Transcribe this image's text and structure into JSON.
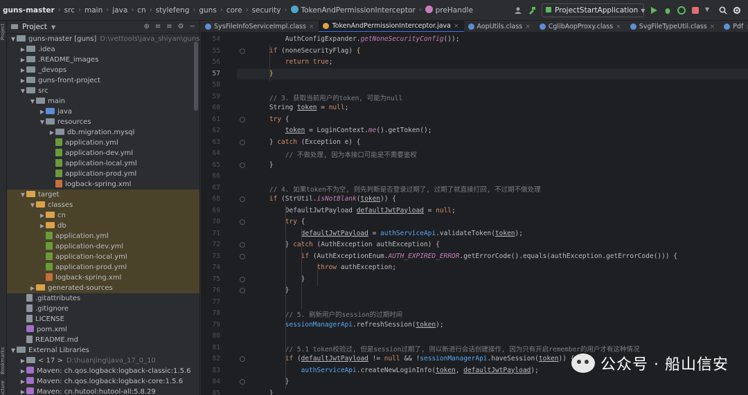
{
  "breadcrumbs": [
    "guns-master",
    "src",
    "main",
    "java",
    "cn",
    "stylefeng",
    "guns",
    "core",
    "security",
    "TokenAndPermissionInterceptor",
    "preHandle"
  ],
  "run_config": "ProjectStartApplication",
  "tool_strip": {
    "project": "Project",
    "bookmarks": "Bookmarks",
    "structure": "Structure"
  },
  "project_panel": {
    "title": "Project"
  },
  "tree": [
    {
      "label": "guns-master [guns]",
      "note": "D:\\vettools\\java_shiyan\\guns-maste",
      "depth": 0,
      "arrow": "v",
      "icon": "folder"
    },
    {
      "label": ".idea",
      "depth": 1,
      "arrow": ">",
      "icon": "folder"
    },
    {
      "label": ".README_images",
      "depth": 1,
      "arrow": ">",
      "icon": "folder"
    },
    {
      "label": "_devops",
      "depth": 1,
      "arrow": ">",
      "icon": "folder"
    },
    {
      "label": "guns-front-project",
      "depth": 1,
      "arrow": ">",
      "icon": "folder"
    },
    {
      "label": "src",
      "depth": 1,
      "arrow": "v",
      "icon": "folder"
    },
    {
      "label": "main",
      "depth": 2,
      "arrow": "v",
      "icon": "folder"
    },
    {
      "label": "java",
      "depth": 3,
      "arrow": ">",
      "icon": "folder-blue"
    },
    {
      "label": "resources",
      "depth": 3,
      "arrow": "v",
      "icon": "folder"
    },
    {
      "label": "db.migration.mysql",
      "depth": 4,
      "arrow": ">",
      "icon": "folder"
    },
    {
      "label": "application.yml",
      "depth": 4,
      "arrow": "",
      "icon": "yml"
    },
    {
      "label": "application-dev.yml",
      "depth": 4,
      "arrow": "",
      "icon": "yml"
    },
    {
      "label": "application-local.yml",
      "depth": 4,
      "arrow": "",
      "icon": "yml"
    },
    {
      "label": "application-prod.yml",
      "depth": 4,
      "arrow": "",
      "icon": "yml"
    },
    {
      "label": "logback-spring.xml",
      "depth": 4,
      "arrow": "",
      "icon": "xml"
    },
    {
      "label": "target",
      "depth": 1,
      "arrow": "v",
      "icon": "folder-orange",
      "hl": true
    },
    {
      "label": "classes",
      "depth": 2,
      "arrow": "v",
      "icon": "folder-orange",
      "hl": true
    },
    {
      "label": "cn",
      "depth": 3,
      "arrow": ">",
      "icon": "folder-orange",
      "hl": true
    },
    {
      "label": "db",
      "depth": 3,
      "arrow": ">",
      "icon": "folder-orange",
      "hl": true
    },
    {
      "label": "application.yml",
      "depth": 3,
      "arrow": "",
      "icon": "yml",
      "hl": true
    },
    {
      "label": "application-dev.yml",
      "depth": 3,
      "arrow": "",
      "icon": "yml",
      "hl": true
    },
    {
      "label": "application-local.yml",
      "depth": 3,
      "arrow": "",
      "icon": "yml",
      "hl": true
    },
    {
      "label": "application-prod.yml",
      "depth": 3,
      "arrow": "",
      "icon": "yml",
      "hl": true
    },
    {
      "label": "logback-spring.xml",
      "depth": 3,
      "arrow": "",
      "icon": "xml",
      "hl": true
    },
    {
      "label": "generated-sources",
      "depth": 2,
      "arrow": ">",
      "icon": "folder-orange",
      "hl": true
    },
    {
      "label": ".gitattributes",
      "depth": 1,
      "arrow": "",
      "icon": "txt"
    },
    {
      "label": ".gitignore",
      "depth": 1,
      "arrow": "",
      "icon": "txt"
    },
    {
      "label": "LICENSE",
      "depth": 1,
      "arrow": "",
      "icon": "txt"
    },
    {
      "label": "pom.xml",
      "depth": 1,
      "arrow": "",
      "icon": "mvn"
    },
    {
      "label": "README.md",
      "depth": 1,
      "arrow": "",
      "icon": "txt"
    },
    {
      "label": "External Libraries",
      "depth": 0,
      "arrow": "v",
      "icon": "folder"
    },
    {
      "label": "< 17 >",
      "note": "D:\\huanjing\\java_17_0_10",
      "depth": 1,
      "arrow": ">",
      "icon": "folder"
    },
    {
      "label": "Maven: ch.qos.logback:logback-classic:1.5.6",
      "depth": 1,
      "arrow": ">",
      "icon": "mvn"
    },
    {
      "label": "Maven: ch.qos.logback:logback-core:1.5.6",
      "depth": 1,
      "arrow": ">",
      "icon": "mvn"
    },
    {
      "label": "Maven: cn.hutool:hutool-all:5.8.29",
      "depth": 1,
      "arrow": ">",
      "icon": "mvn"
    }
  ],
  "tabs": [
    {
      "label": "SysFileInfoServiceImpl.class",
      "color": "#5d8ed6",
      "active": false
    },
    {
      "label": "TokenAndPermissionInterceptor.java",
      "color": "#d9a34b",
      "active": true
    },
    {
      "label": "AopUtils.class",
      "color": "#5d8ed6",
      "active": false
    },
    {
      "label": "CglibAopProxy.class",
      "color": "#5d8ed6",
      "active": false
    },
    {
      "label": "SvgFileTypeUtil.class",
      "color": "#5d8ed6",
      "active": false
    },
    {
      "label": "Pdf",
      "color": "#5d8ed6",
      "active": false
    }
  ],
  "current_line": "57",
  "code_lines": [
    {
      "n": "54",
      "html": "        AuthConfigExpander.<span class=\"s\">getNoneSecurityConfig</span>());"
    },
    {
      "n": "55",
      "html": "    <span class=\"k\">if</span> (noneSecurityFlag) <span class=\"b\">{</span>"
    },
    {
      "n": "56",
      "html": "        <span class=\"k\">return true</span>;"
    },
    {
      "n": "57",
      "html": "    <span class=\"b\">}</span>"
    },
    {
      "n": "58",
      "html": ""
    },
    {
      "n": "59",
      "html": "    <span class=\"c\">// 3. 获取当前用户的token, 可能为null</span>"
    },
    {
      "n": "60",
      "html": "    String <span class=\"u\">token</span> = <span class=\"k\">null</span>;"
    },
    {
      "n": "61",
      "html": "    <span class=\"k\">try</span> {"
    },
    {
      "n": "62",
      "html": "        <span class=\"u\">token</span> = LoginContext.<span class=\"s\">me</span>().getToken();"
    },
    {
      "n": "63",
      "html": "    } <span class=\"k\">catch</span> (Exception e) {"
    },
    {
      "n": "64",
      "html": "        <span class=\"c\">// 不做处理, 因为本接口可能是不需要鉴权</span>"
    },
    {
      "n": "65",
      "html": "    }"
    },
    {
      "n": "66",
      "html": ""
    },
    {
      "n": "67",
      "html": "    <span class=\"c\">// 4. 如果token不为空, 则先判断是否登录过期了, 过期了就直接打回, 不过期不做处理</span>"
    },
    {
      "n": "68",
      "html": "    <span class=\"k\">if</span> (StrUtil.<span class=\"s\">isNotBlank</span>(<span class=\"u\">token</span>)) {"
    },
    {
      "n": "69",
      "html": "        DefaultJwtPayload <span class=\"u\">defaultJwtPayload</span> = <span class=\"k\">null</span>;"
    },
    {
      "n": "70",
      "html": "        <span class=\"k\">try</span> {"
    },
    {
      "n": "71",
      "html": "            <span class=\"u\">defaultJwtPayload</span> = <span class=\"f\">authServiceApi</span>.validateToken(<span class=\"u\">token</span>);"
    },
    {
      "n": "72",
      "html": "        } <span class=\"k\">catch</span> (AuthException authException) {"
    },
    {
      "n": "73",
      "html": "            <span class=\"k\">if</span> (AuthExceptionEnum.<span class=\"s\">AUTH_EXPIRED_ERROR</span>.getErrorCode().equals(authException.getErrorCode())) {"
    },
    {
      "n": "74",
      "html": "                <span class=\"k\">throw</span> authException;"
    },
    {
      "n": "75",
      "html": "            }"
    },
    {
      "n": "76",
      "html": "        }"
    },
    {
      "n": "77",
      "html": ""
    },
    {
      "n": "78",
      "html": "        <span class=\"c\">// 5. 刷新用户的session的过期时间</span>"
    },
    {
      "n": "79",
      "html": "        <span class=\"f\">sessionManagerApi</span>.refreshSession(<span class=\"u\">token</span>);"
    },
    {
      "n": "80",
      "html": ""
    },
    {
      "n": "81",
      "html": "        <span class=\"c\">// 5.1 token校验过, 但是session过期了, 则以新进行会话创建操作, 因为只有开启remember的用户才有这种情况</span>"
    },
    {
      "n": "82",
      "html": "        <span class=\"k\">if</span> (<span class=\"u\">defaultJwtPayload</span> != <span class=\"k\">null</span> &amp;&amp; !<span class=\"f\">sessionManagerApi</span>.haveSession(<span class=\"u\">token</span>)) {"
    },
    {
      "n": "83",
      "html": "            <span class=\"f\">authServiceApi</span>.createNewLoginInfo(<span class=\"u\">token</span>, <span class=\"u\">defaultJwtPayload</span>);"
    },
    {
      "n": "84",
      "html": "        }"
    },
    {
      "n": "85",
      "html": "    }"
    }
  ],
  "watermark": "公众号 · 船山信安"
}
